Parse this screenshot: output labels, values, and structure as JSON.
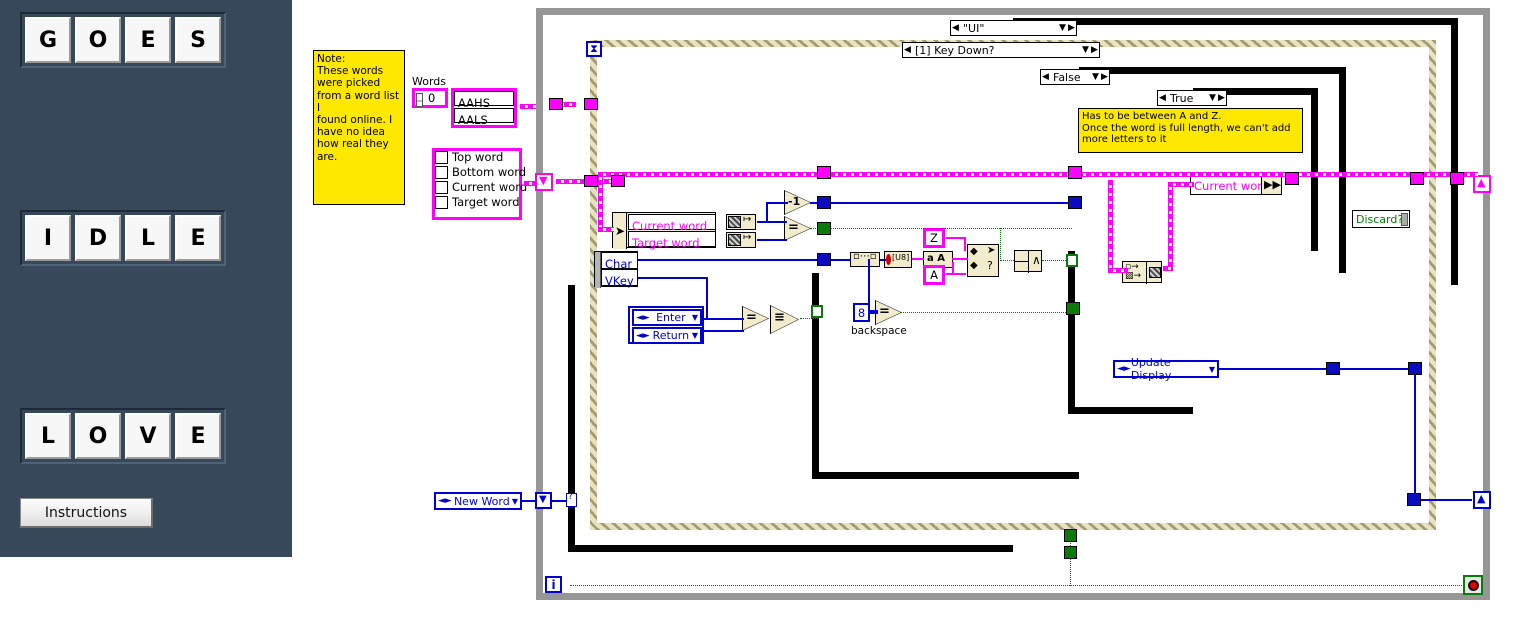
{
  "front_panel": {
    "rows": [
      {
        "name": "top-word-row",
        "letters": [
          "G",
          "O",
          "E",
          "S"
        ]
      },
      {
        "name": "current-word-row",
        "letters": [
          "I",
          "D",
          "L",
          "E"
        ]
      },
      {
        "name": "bottom-word-row",
        "letters": [
          "L",
          "O",
          "V",
          "E"
        ]
      }
    ],
    "instructions_button": "Instructions",
    "background_color": "#36485a",
    "tile_color": "#f7f7f7"
  },
  "diagram": {
    "note_comment": "Note:\nThese words\nwere picked\nfrom a word list I\nfound online. I\nhave no idea\nhow real they\nare.",
    "words_label": "Words",
    "words_index_value": "0",
    "words_array": [
      "AAHS",
      "AALS"
    ],
    "cluster_items": [
      "Top word",
      "Bottom word",
      "Current word",
      "Target word"
    ],
    "event_structure_case": "\"UI\"",
    "event_case": "[1] Key Down?",
    "outer_case": "False",
    "inner_case": "True",
    "inner_comment": "Has to be between A and Z.\nOnce the word is full length, we can't add\nmore letters to it",
    "bundle_labels": [
      "Current word",
      "Target word"
    ],
    "event_terminals": [
      "Char",
      "VKey"
    ],
    "enum_enter": "Enter",
    "enum_return": "Return",
    "backspace_constant": "8",
    "backspace_label": "backspace",
    "letter_z_constant": "Z",
    "letter_a_constant": "A",
    "decrement_glyph": "-1",
    "equal_glyph": "=",
    "or_glyph": "≡",
    "and_glyph": "∧",
    "current_word_indicator": "Current word",
    "discard_indicator": "Discard?",
    "update_display_enum": "Update Display",
    "new_word_enum": "New Word",
    "loop_index": "i",
    "timeout_icon": "hourglass-icon",
    "stop_icon": "stop-button-icon"
  },
  "colors": {
    "string_magenta": "#ff00ff",
    "numeric_blue": "#0000d0",
    "boolean_green": "#007a00",
    "comment_yellow": "#ffe800",
    "panel_blue": "#36485a"
  }
}
